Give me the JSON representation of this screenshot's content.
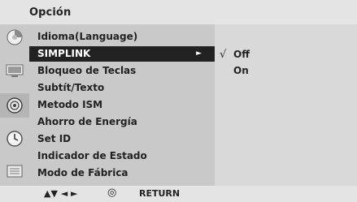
{
  "header": {
    "title": "Opción"
  },
  "icons": [
    {
      "name": "picture-icon"
    },
    {
      "name": "sound-icon"
    },
    {
      "name": "disc-icon"
    },
    {
      "name": "clock-icon"
    },
    {
      "name": "tools-icon"
    }
  ],
  "menu": {
    "items": [
      {
        "label": "Idioma(Language)"
      },
      {
        "label": "SIMPLINK",
        "selected": true,
        "arrow": "►"
      },
      {
        "label": "Bloqueo de Teclas"
      },
      {
        "label": "Subtít/Texto"
      },
      {
        "label": "Metodo ISM"
      },
      {
        "label": "Ahorro de Energía"
      },
      {
        "label": "Set ID"
      },
      {
        "label": "Indicador de Estado"
      },
      {
        "label": "Modo de Fábrica"
      }
    ]
  },
  "submenu": {
    "items": [
      {
        "label": "Off",
        "check": "√"
      },
      {
        "label": "On",
        "check": ""
      }
    ]
  },
  "footer": {
    "nav_arrows": "▲▼ ◄ ►",
    "ok_symbol": "◎",
    "return_label": "RETURN"
  }
}
